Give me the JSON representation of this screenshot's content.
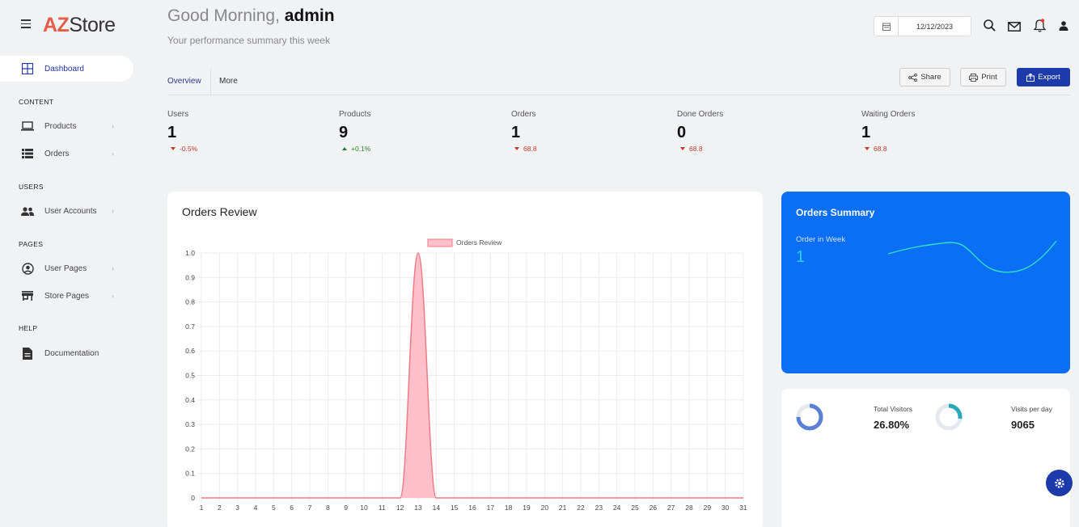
{
  "app": {
    "logo_az": "AZ",
    "logo_store": "Store"
  },
  "sidebar": {
    "dashboard": "Dashboard",
    "sections": {
      "content": "CONTENT",
      "users": "USERS",
      "pages": "PAGES",
      "help": "HELP"
    },
    "items": {
      "products": "Products",
      "orders": "Orders",
      "user_accounts": "User Accounts",
      "user_pages": "User Pages",
      "store_pages": "Store Pages",
      "documentation": "Documentation"
    },
    "chevron": "›"
  },
  "header": {
    "greeting_prefix": "Good Morning, ",
    "user_name": "admin",
    "subtitle": "Your performance summary this week",
    "date_value": "12/12/2023"
  },
  "tabs": {
    "overview": "Overview",
    "more": "More"
  },
  "actions": {
    "share": "Share",
    "print": "Print",
    "export": "Export"
  },
  "stats": [
    {
      "label": "Users",
      "value": "1",
      "change": "-0.5%",
      "direction": "down"
    },
    {
      "label": "Products",
      "value": "9",
      "change": "+0.1%",
      "direction": "up"
    },
    {
      "label": "Orders",
      "value": "1",
      "change": "68.8",
      "direction": "down"
    },
    {
      "label": "Done Orders",
      "value": "0",
      "change": "68.8",
      "direction": "down"
    },
    {
      "label": "Waiting Orders",
      "value": "1",
      "change": "68.8",
      "direction": "down"
    }
  ],
  "orders_review": {
    "title": "Orders Review"
  },
  "orders_summary": {
    "title": "Orders Summary",
    "sub_label": "Order in Week",
    "value": "1"
  },
  "visitors": {
    "total_visitors_label": "Total Visitors",
    "total_visitors_value": "26.80%",
    "visits_per_day_label": "Visits per day",
    "visits_per_day_value": "9065"
  },
  "colors": {
    "primary": "#1c3aa9",
    "summary_card": "#0b6ef6",
    "chart_fill": "#ffc0cb",
    "chart_line": "#ef7a83",
    "down": "#c0392b",
    "up": "#2e7d32"
  },
  "chart_data": {
    "type": "area",
    "legend": "Orders Review",
    "x": [
      1,
      2,
      3,
      4,
      5,
      6,
      7,
      8,
      9,
      10,
      11,
      12,
      13,
      14,
      15,
      16,
      17,
      18,
      19,
      20,
      21,
      22,
      23,
      24,
      25,
      26,
      27,
      28,
      29,
      30,
      31
    ],
    "values": [
      0,
      0,
      0,
      0,
      0,
      0,
      0,
      0,
      0,
      0,
      0,
      0,
      1,
      0,
      0,
      0,
      0,
      0,
      0,
      0,
      0,
      0,
      0,
      0,
      0,
      0,
      0,
      0,
      0,
      0,
      0
    ],
    "ylim": [
      0,
      1.0
    ],
    "yticks": [
      "0",
      "0.1",
      "0.2",
      "0.3",
      "0.4",
      "0.5",
      "0.6",
      "0.7",
      "0.8",
      "0.9",
      "1.0"
    ],
    "grid": true,
    "legend_position": "top"
  }
}
